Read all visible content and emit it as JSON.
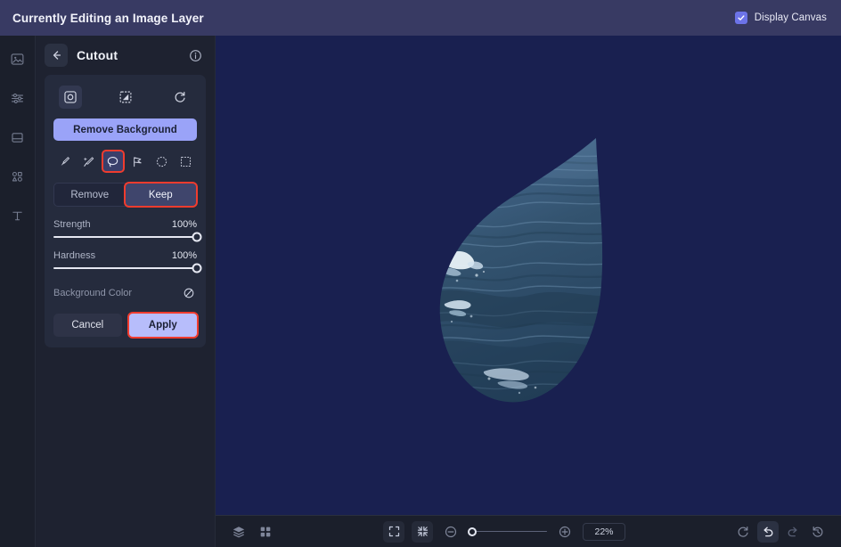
{
  "topbar": {
    "title": "Currently Editing an Image Layer",
    "display_canvas_label": "Display Canvas",
    "display_canvas_checked": true,
    "bg_color": "#383a63"
  },
  "rail": {
    "items": [
      {
        "name": "image-icon",
        "label": "Image"
      },
      {
        "name": "adjustments-icon",
        "label": "Adjustments"
      },
      {
        "name": "frame-icon",
        "label": "Frame"
      },
      {
        "name": "shapes-icon",
        "label": "Shapes"
      },
      {
        "name": "text-icon",
        "label": "Text"
      }
    ]
  },
  "panel": {
    "title": "Cutout",
    "back_icon": "arrow-left-icon",
    "info_icon": "info-icon",
    "modes": [
      {
        "name": "cutout-object-icon",
        "active": true
      },
      {
        "name": "mask-contrast-icon",
        "active": false
      },
      {
        "name": "reset-refresh-icon",
        "active": false
      }
    ],
    "remove_background_label": "Remove Background",
    "tools": [
      {
        "name": "brush-tool-icon",
        "active": false,
        "highlighted": false
      },
      {
        "name": "magic-wand-tool-icon",
        "active": false,
        "highlighted": false
      },
      {
        "name": "lasso-tool-icon",
        "active": true,
        "highlighted": true
      },
      {
        "name": "polygon-lasso-tool-icon",
        "active": false,
        "highlighted": false
      },
      {
        "name": "ellipse-select-tool-icon",
        "active": false,
        "highlighted": false
      },
      {
        "name": "rectangle-select-tool-icon",
        "active": false,
        "highlighted": false
      }
    ],
    "segmented": {
      "remove_label": "Remove",
      "keep_label": "Keep",
      "selected": "Keep",
      "keep_highlighted": true
    },
    "sliders": [
      {
        "label": "Strength",
        "value": "100%",
        "percent": 100
      },
      {
        "label": "Hardness",
        "value": "100%",
        "percent": 100
      }
    ],
    "background_color": {
      "label": "Background Color",
      "value": "none",
      "swatch_icon": "no-color-icon"
    },
    "actions": {
      "cancel_label": "Cancel",
      "apply_label": "Apply",
      "apply_highlighted": true
    },
    "accent_color": "#9aa3f8",
    "highlight_color": "#f03c2e"
  },
  "canvas": {
    "background_color": "#192050",
    "layer_shape": "teardrop",
    "layer_content": "ocean water photo"
  },
  "bottombar": {
    "layers_icon": "layers-icon",
    "grid_icon": "grid-icon",
    "fit_icon": "fit-to-screen-icon",
    "collapse_icon": "shrink-to-fit-icon",
    "zoom_out_icon": "zoom-out-icon",
    "zoom_in_icon": "zoom-in-icon",
    "zoom_level": "22%",
    "zoom_percent": 22,
    "reset_icon": "reset-view-icon",
    "undo_icon": "undo-icon",
    "redo_icon": "redo-icon",
    "history_icon": "history-icon"
  }
}
